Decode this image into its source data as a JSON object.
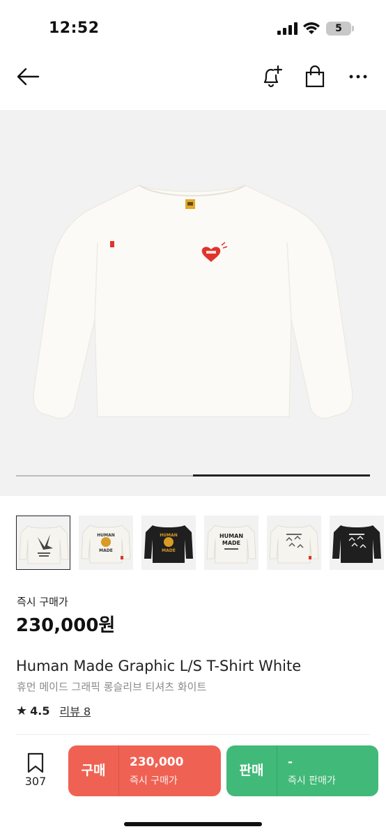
{
  "status_bar": {
    "time": "12:52",
    "battery": "5"
  },
  "product": {
    "price_label": "즉시 구매가",
    "price": "230,000원",
    "title_en": "Human Made Graphic L/S T-Shirt White",
    "title_ko": "휴먼 메이드 그래픽 롱슬리브 티셔츠 화이트",
    "rating": "4.5",
    "review_text": "리뷰 8",
    "image_progress": 0.5
  },
  "thumbnails": [
    {
      "name": "thumb-graphic-bird",
      "color": "#f3f1ec"
    },
    {
      "name": "thumb-tiger-white",
      "color": "#f3f1ec",
      "text": "HUMAN MADE"
    },
    {
      "name": "thumb-tiger-black",
      "color": "#1f1f1f",
      "text": "HUMAN MADE"
    },
    {
      "name": "thumb-logo-white",
      "color": "#f3f1ec",
      "text": "HUMAN MADE"
    },
    {
      "name": "thumb-birds-white",
      "color": "#f3f1ec"
    },
    {
      "name": "thumb-birds-black",
      "color": "#1f1f1f"
    }
  ],
  "bottom_bar": {
    "wish_count": "307",
    "buy": {
      "label": "구매",
      "amount": "230,000",
      "sub": "즉시 구매가",
      "color": "#ef6253"
    },
    "sell": {
      "label": "판매",
      "amount": "-",
      "sub": "즉시 판매가",
      "color": "#41b979"
    }
  }
}
